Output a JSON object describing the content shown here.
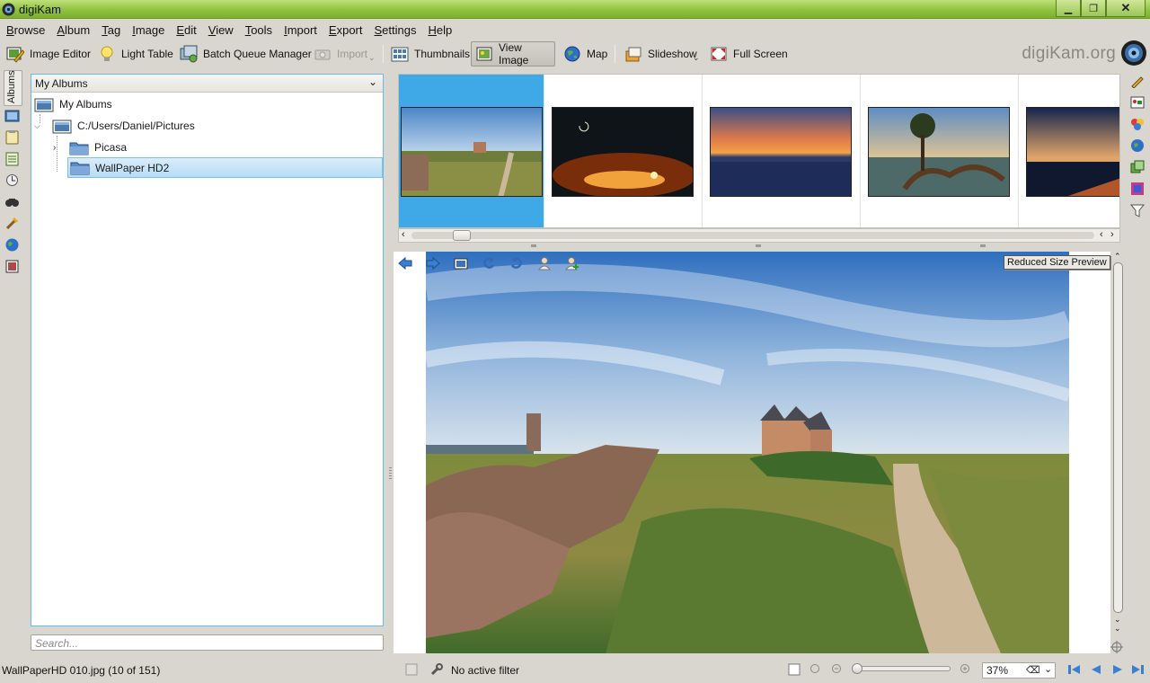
{
  "window": {
    "title": "digiKam",
    "controls": [
      "minimize",
      "maximize",
      "close"
    ]
  },
  "menubar": [
    "Browse",
    "Album",
    "Tag",
    "Image",
    "Edit",
    "View",
    "Tools",
    "Import",
    "Export",
    "Settings",
    "Help"
  ],
  "toolbar": {
    "image_editor": "Image Editor",
    "light_table": "Light Table",
    "batch_queue": "Batch Queue Manager",
    "import": "Import",
    "thumbnails": "Thumbnails",
    "view_image": "View Image",
    "map": "Map",
    "slideshow": "Slideshow",
    "full_screen": "Full Screen",
    "brand": "digiKam.org"
  },
  "left_tabs": {
    "albums": "Albums"
  },
  "albums": {
    "combo": "My Albums",
    "root": "My Albums",
    "path": "C:/Users/Daniel/Pictures",
    "children": [
      "Picasa",
      "WallPaper HD2"
    ],
    "selected": "WallPaper HD2"
  },
  "search": {
    "placeholder": "Search..."
  },
  "thumbnails": {
    "count_visible": 5,
    "selected_index": 0
  },
  "preview": {
    "label": "Reduced Size Preview"
  },
  "status": {
    "file": "WallPaperHD 010.jpg (10 of 151)",
    "filter": "No active filter",
    "zoom": "37%",
    "zoom_level": 0.37
  },
  "colors": {
    "accent": "#3fa8e6",
    "selection": "#c3e2f7",
    "titlebar": "#8fc23e"
  }
}
